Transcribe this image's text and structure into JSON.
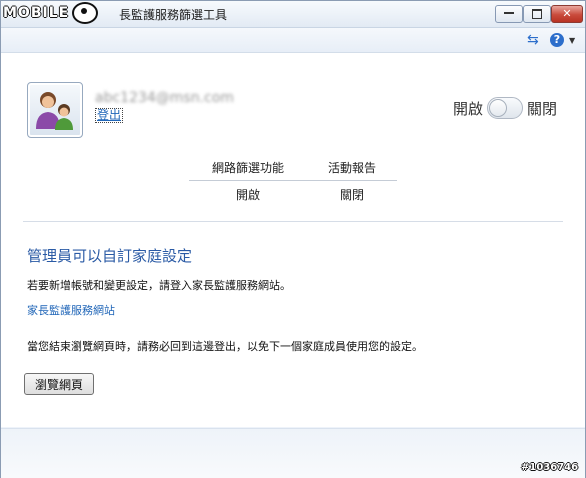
{
  "window": {
    "logo_text": "MOBILE",
    "title": "長監護服務篩選工具"
  },
  "user": {
    "name": "abc1234@msn.com",
    "logout_label": "登出"
  },
  "toggle": {
    "on_label": "開啟",
    "off_label": "關閉",
    "state": "off"
  },
  "status_table": {
    "headers": [
      "網路篩選功能",
      "活動報告"
    ],
    "values": [
      "開啟",
      "關閉"
    ]
  },
  "admin_section": {
    "title": "管理員可以自訂家庭設定",
    "description": "若要新增帳號和變更設定，請登入家長監護服務網站。",
    "link_text": "家長監護服務網站",
    "notice": "當您結束瀏覽網頁時，請務必回到這邊登出，以免下一個家庭成員使用您的設定。",
    "browse_button": "瀏覽網頁"
  },
  "watermark": "#1036746"
}
